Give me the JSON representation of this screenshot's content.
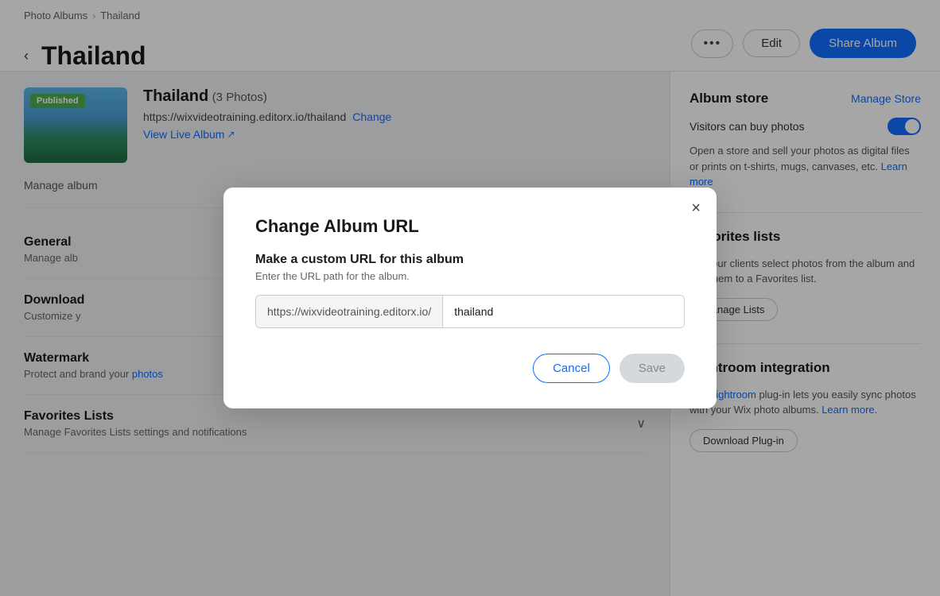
{
  "breadcrumb": {
    "parent": "Photo Albums",
    "current": "Thailand"
  },
  "header": {
    "back_label": "‹",
    "title": "Thailand",
    "dots_label": "•••",
    "edit_label": "Edit",
    "share_label": "Share Album"
  },
  "album": {
    "name": "Thailand",
    "photo_count": "(3 Photos)",
    "url": "https://wixvideotraining.editorx.io/thailand",
    "change_label": "Change",
    "view_live_label": "View Live Album",
    "published_badge": "Published"
  },
  "manage_album": {
    "text": "Manage album"
  },
  "settings": {
    "general": {
      "title": "General",
      "desc": "Manage alb"
    },
    "download": {
      "title": "Download",
      "desc": "Customize y"
    },
    "watermark": {
      "title": "Watermark",
      "desc": "Protect and brand your photos"
    },
    "favorites_lists": {
      "title": "Favorites Lists",
      "desc": "Manage Favorites Lists settings and notifications"
    }
  },
  "right_panel": {
    "album_store": {
      "title": "Album store",
      "manage_label": "Manage Store",
      "toggle_label": "Visitors can buy photos",
      "toggle_on": true,
      "desc": "Open a store and sell your photos as digital files or prints on t-shirts, mugs, canvases, etc.",
      "learn_more": "Learn more"
    },
    "favorites_lists": {
      "title": "Favorites lists",
      "desc": "Let your clients select photos from the album and add them to a Favorites list.",
      "manage_label": "Manage Lists"
    },
    "lightroom": {
      "title": "Lightroom integration",
      "desc": "The Lightroom plug-in lets you easily sync photos with your Wix photo albums.",
      "learn_more_label": "Learn more.",
      "download_plugin_label": "Download Plug-in"
    }
  },
  "modal": {
    "title": "Change Album URL",
    "subtitle": "Make a custom URL for this album",
    "hint": "Enter the URL path for the album.",
    "url_base": "https://wixvideotraining.editorx.io/",
    "url_path_value": "thailand",
    "url_path_placeholder": "thailand",
    "cancel_label": "Cancel",
    "save_label": "Save",
    "close_label": "×"
  }
}
